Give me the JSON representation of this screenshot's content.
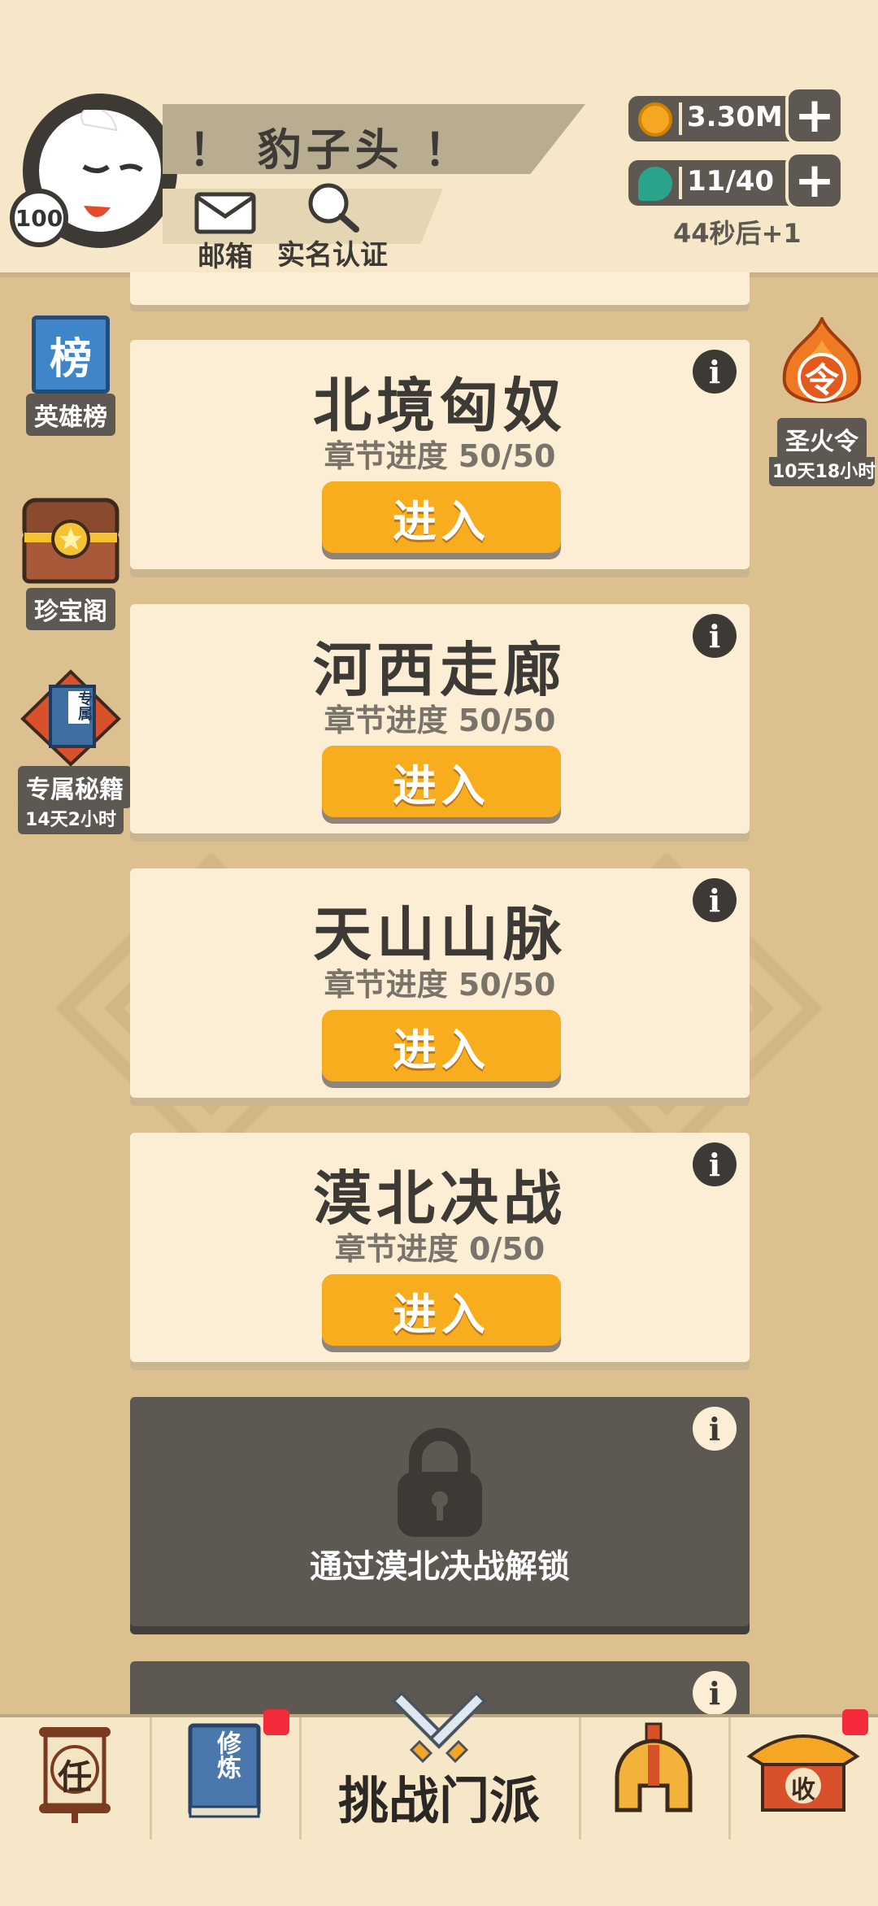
{
  "header": {
    "player_name": "！ 豹子头 ！",
    "level": "100",
    "mailbox_label": "邮箱",
    "realname_label": "实名认证",
    "gold_value": "3.30M",
    "stamina_value": "11/40",
    "stamina_timer": "44秒后+1"
  },
  "side_left": [
    {
      "label": "英雄榜",
      "icon_text": "榜"
    },
    {
      "label": "珍宝阁"
    },
    {
      "label": "专属秘籍",
      "sub": "14天2小时",
      "icon_text": "专属"
    }
  ],
  "side_right": {
    "label": "圣火令",
    "sub": "10天18小时",
    "icon_text": "令"
  },
  "chapters": [
    {
      "title": "北境匈奴",
      "progress": "章节进度 50/50",
      "button": "进入"
    },
    {
      "title": "河西走廊",
      "progress": "章节进度 50/50",
      "button": "进入"
    },
    {
      "title": "天山山脉",
      "progress": "章节进度 50/50",
      "button": "进入"
    },
    {
      "title": "漠北决战",
      "progress": "章节进度 0/50",
      "button": "进入"
    }
  ],
  "locked_chapter": {
    "text": "通过漠北决战解锁"
  },
  "bottom_nav": {
    "task_icon_text": "任",
    "cultivate_icon_text": "修炼",
    "challenge_label": "挑战门派",
    "collect_icon_text": "收"
  },
  "colors": {
    "accent": "#f8ad1e",
    "dark": "#3d3935",
    "card": "#fbeed4",
    "bg": "#dcc090",
    "badge": "#f22a3a"
  }
}
